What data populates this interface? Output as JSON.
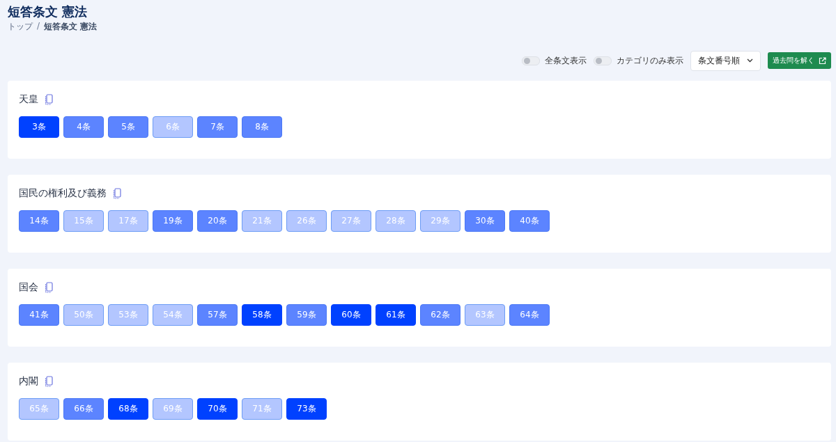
{
  "header": {
    "title": "短答条文 憲法",
    "breadcrumb_separator": "/",
    "breadcrumb": [
      {
        "label": "トップ",
        "kind": "link"
      },
      {
        "label": "短答条文 憲法",
        "kind": "current"
      }
    ]
  },
  "toolbar": {
    "toggles": [
      {
        "label": "全条文表示",
        "on": false
      },
      {
        "label": "カテゴリのみ表示",
        "on": false
      }
    ],
    "sort": {
      "value": "条文番号順"
    },
    "action": {
      "label": "過去問を解く"
    }
  },
  "categories": [
    {
      "title": "天皇",
      "articles": [
        {
          "label": "3条",
          "kind": "strong"
        },
        {
          "label": "4条",
          "kind": "medium"
        },
        {
          "label": "5条",
          "kind": "medium"
        },
        {
          "label": "6条",
          "kind": "weak"
        },
        {
          "label": "7条",
          "kind": "medium"
        },
        {
          "label": "8条",
          "kind": "medium"
        }
      ]
    },
    {
      "title": "国民の権利及び義務",
      "articles": [
        {
          "label": "14条",
          "kind": "medium"
        },
        {
          "label": "15条",
          "kind": "weak"
        },
        {
          "label": "17条",
          "kind": "weak"
        },
        {
          "label": "19条",
          "kind": "medium"
        },
        {
          "label": "20条",
          "kind": "medium"
        },
        {
          "label": "21条",
          "kind": "weak"
        },
        {
          "label": "26条",
          "kind": "weak"
        },
        {
          "label": "27条",
          "kind": "weak"
        },
        {
          "label": "28条",
          "kind": "weak"
        },
        {
          "label": "29条",
          "kind": "weak"
        },
        {
          "label": "30条",
          "kind": "medium"
        },
        {
          "label": "40条",
          "kind": "medium"
        }
      ]
    },
    {
      "title": "国会",
      "articles": [
        {
          "label": "41条",
          "kind": "medium"
        },
        {
          "label": "50条",
          "kind": "weak"
        },
        {
          "label": "53条",
          "kind": "weak"
        },
        {
          "label": "54条",
          "kind": "weak"
        },
        {
          "label": "57条",
          "kind": "medium"
        },
        {
          "label": "58条",
          "kind": "strong"
        },
        {
          "label": "59条",
          "kind": "medium"
        },
        {
          "label": "60条",
          "kind": "strong"
        },
        {
          "label": "61条",
          "kind": "strong"
        },
        {
          "label": "62条",
          "kind": "medium"
        },
        {
          "label": "63条",
          "kind": "weak"
        },
        {
          "label": "64条",
          "kind": "medium"
        }
      ]
    },
    {
      "title": "内閣",
      "articles": [
        {
          "label": "65条",
          "kind": "weak"
        },
        {
          "label": "66条",
          "kind": "medium"
        },
        {
          "label": "68条",
          "kind": "strong"
        },
        {
          "label": "69条",
          "kind": "weak"
        },
        {
          "label": "70条",
          "kind": "strong"
        },
        {
          "label": "71条",
          "kind": "weak"
        },
        {
          "label": "73条",
          "kind": "strong"
        }
      ]
    }
  ]
}
